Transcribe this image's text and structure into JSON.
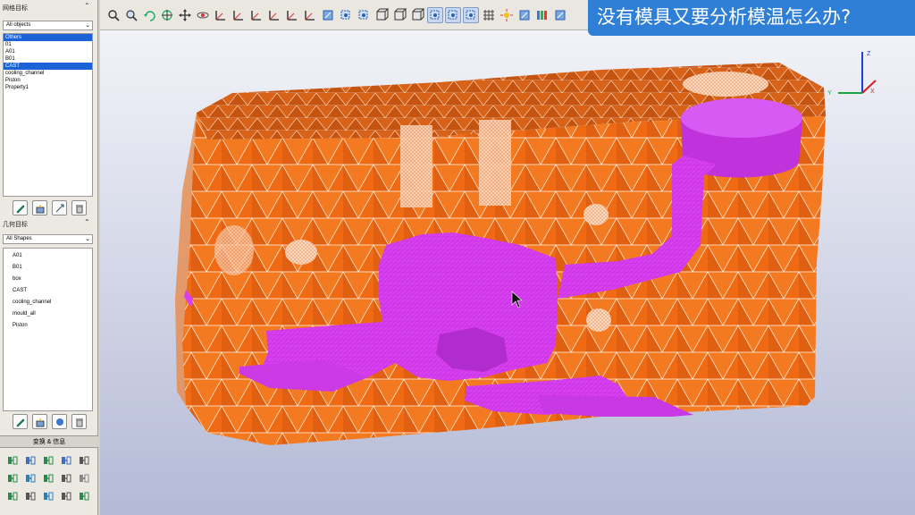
{
  "mesh_panel": {
    "title": "网格目标",
    "filter_value": "All objects",
    "items": [
      {
        "label": "Others",
        "selected": true
      },
      {
        "label": "01",
        "selected": false
      },
      {
        "label": "A01",
        "selected": false
      },
      {
        "label": "B01",
        "selected": false
      },
      {
        "label": "CAST",
        "selected": true
      },
      {
        "label": "cooling_channel",
        "selected": false
      },
      {
        "label": "Piston",
        "selected": false
      },
      {
        "label": "Property1",
        "selected": false
      }
    ]
  },
  "geometry_panel": {
    "title": "几何目标",
    "filter_value": "All Shapes",
    "items": [
      "A01",
      "B01",
      "box",
      "CAST",
      "cooling_channel",
      "mould_all",
      "Piston"
    ]
  },
  "transform_panel": {
    "title": "变换 & 信息"
  },
  "caption": {
    "text": "没有模具又要分析模温怎么办?"
  },
  "axes": {
    "x": "X",
    "y": "Y",
    "z": "Z"
  },
  "colors": {
    "mold": "#f06a14",
    "cast": "#d83ff0",
    "selection": "#1b62d6",
    "banner": "#2f7fd6"
  },
  "toolbar_icons": [
    "zoom",
    "zoom-select",
    "rotate",
    "target",
    "pan",
    "orbit",
    "axis-x",
    "axis-y",
    "axis-z",
    "axis-nx",
    "axis-ny",
    "axis-nz",
    "iso",
    "zoom-box",
    "zoom-fit",
    "shade",
    "wire",
    "box-select",
    "select-1",
    "select-2",
    "select-3",
    "grid",
    "light",
    "probe",
    "palette",
    "view"
  ]
}
